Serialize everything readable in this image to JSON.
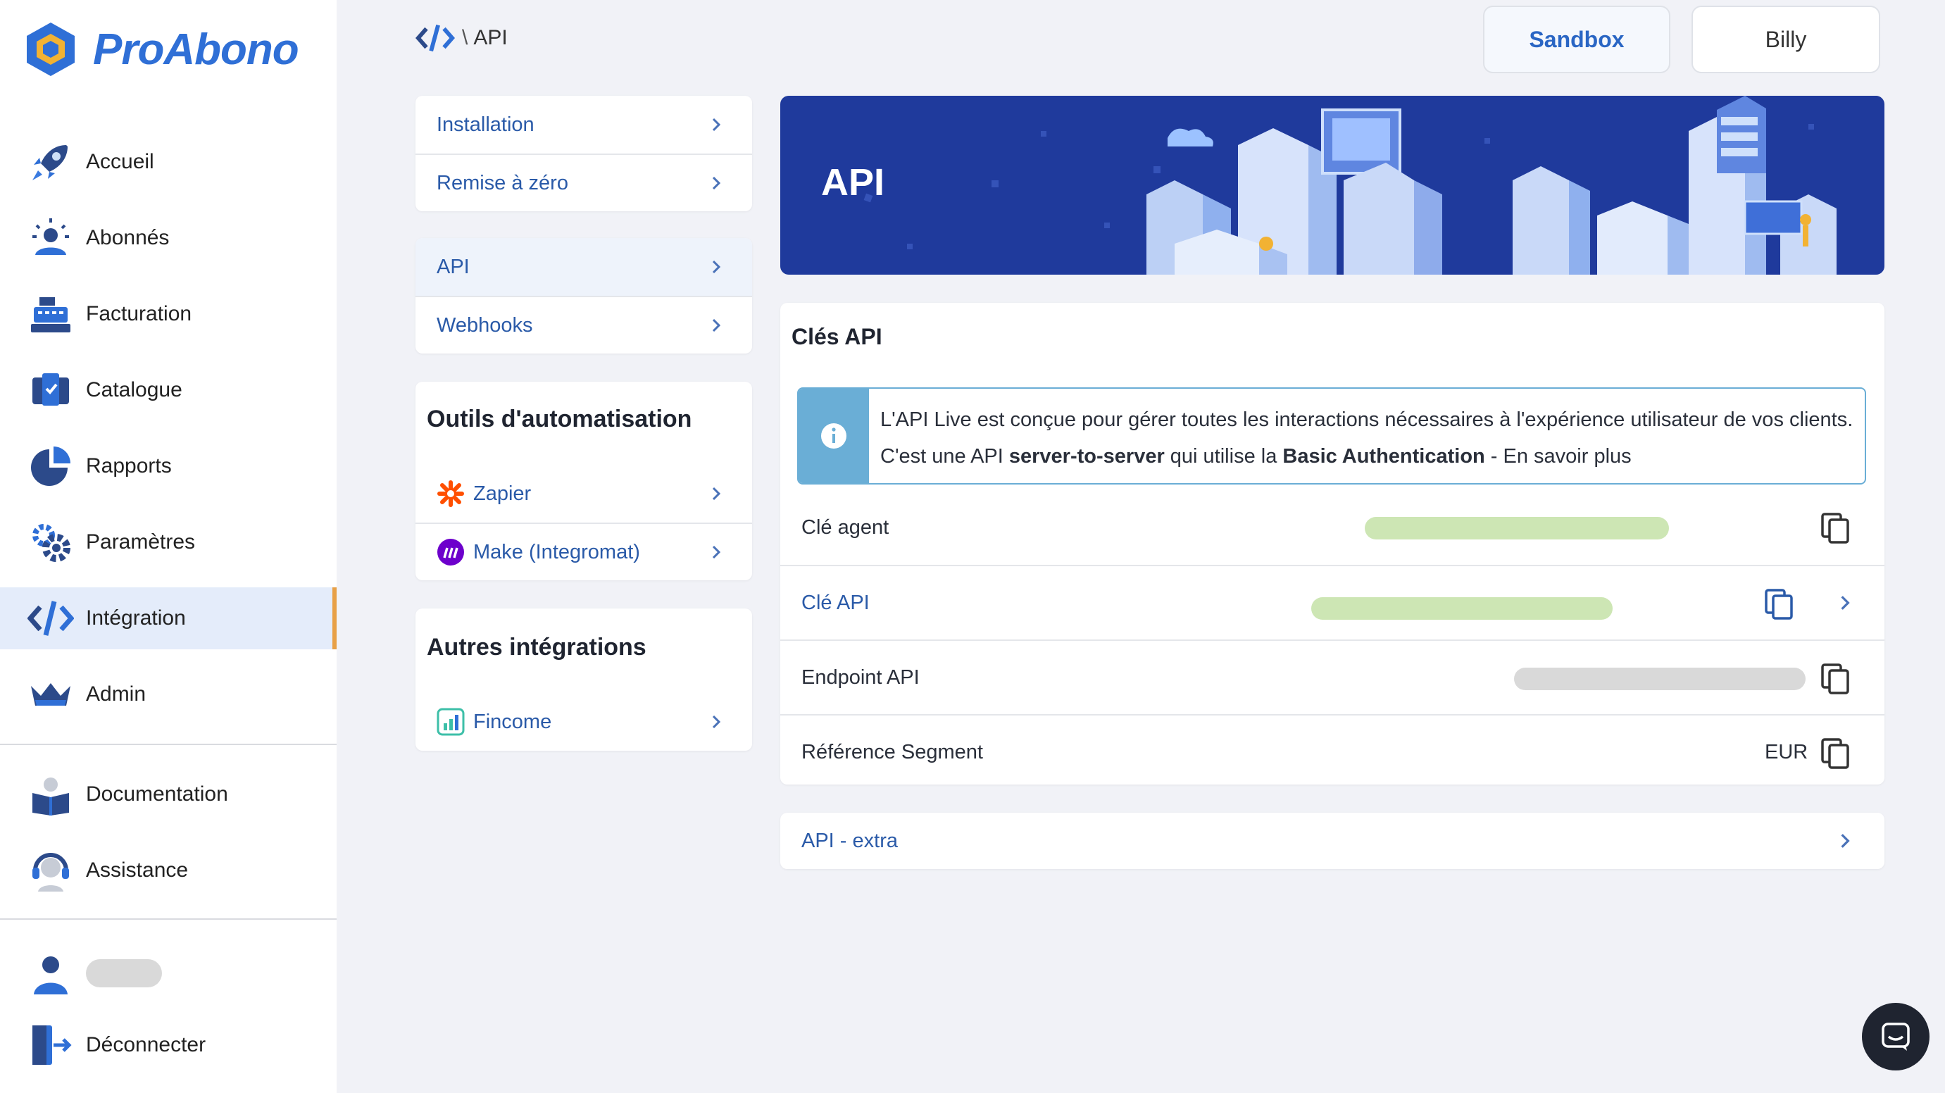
{
  "brand": {
    "name": "ProAbono",
    "accent": "#2f6fd6",
    "active_marker": "#e8a046"
  },
  "sidebar": {
    "items": [
      {
        "label": "Accueil",
        "icon": "rocket-icon"
      },
      {
        "label": "Abonnés",
        "icon": "users-icon"
      },
      {
        "label": "Facturation",
        "icon": "cash-register-icon"
      },
      {
        "label": "Catalogue",
        "icon": "catalog-icon"
      },
      {
        "label": "Rapports",
        "icon": "pie-chart-icon"
      },
      {
        "label": "Paramètres",
        "icon": "gear-icon"
      },
      {
        "label": "Intégration",
        "icon": "code-icon",
        "active": true
      },
      {
        "label": "Admin",
        "icon": "crown-icon"
      }
    ],
    "secondary": [
      {
        "label": "Documentation",
        "icon": "book-icon"
      },
      {
        "label": "Assistance",
        "icon": "headset-icon"
      }
    ],
    "logout_label": "Déconnecter"
  },
  "header": {
    "breadcrumb": {
      "separator": "\\",
      "current": "API"
    },
    "sandbox_label": "Sandbox",
    "account_label": "Billy"
  },
  "subnav": {
    "group1": [
      "Installation",
      "Remise à zéro"
    ],
    "group2": [
      "API",
      "Webhooks"
    ],
    "selected": "API"
  },
  "automation": {
    "title": "Outils d'automatisation",
    "items": [
      {
        "label": "Zapier",
        "icon": "zapier-icon"
      },
      {
        "label": "Make (Integromat)",
        "icon": "make-icon"
      }
    ]
  },
  "other_integrations": {
    "title": "Autres intégrations",
    "items": [
      {
        "label": "Fincome",
        "icon": "fincome-icon"
      }
    ]
  },
  "banner": {
    "title": "API"
  },
  "keys": {
    "title": "Clés API",
    "info_line1": "L'API Live est conçue pour gérer toutes les interactions nécessaires à l'expérience utilisateur de vos clients.",
    "info_line2_a": "C'est une API ",
    "info_line2_b": "server-to-server",
    "info_line2_c": " qui utilise la ",
    "info_line2_d": "Basic Authentication",
    "info_line2_e": " - En savoir plus",
    "rows": [
      {
        "label": "Clé agent"
      },
      {
        "label": "Clé API"
      },
      {
        "label": "Endpoint API"
      },
      {
        "label": "Référence Segment",
        "value": "EUR"
      }
    ]
  },
  "extra": {
    "label": "API - extra"
  }
}
